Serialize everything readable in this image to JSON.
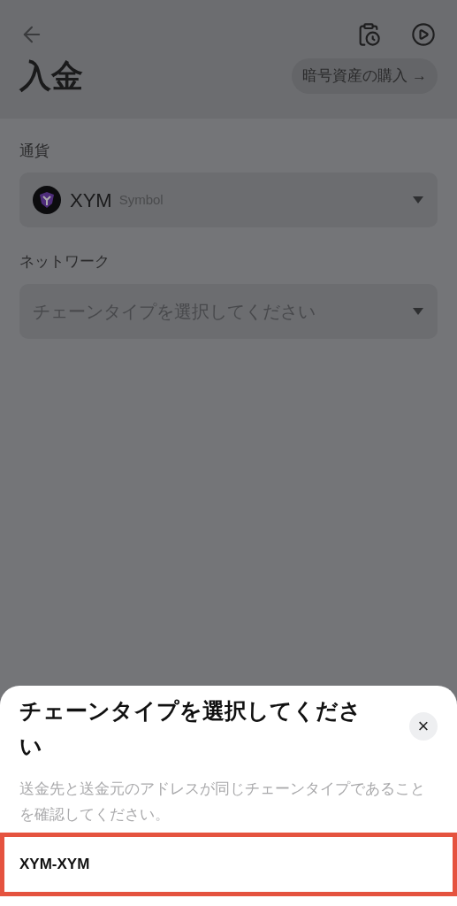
{
  "header": {
    "title": "入金",
    "buy_button": "暗号資産の購入 →"
  },
  "currency": {
    "label": "通貨",
    "code": "XYM",
    "name": "Symbol"
  },
  "network": {
    "label": "ネットワーク",
    "placeholder": "チェーンタイプを選択してください"
  },
  "sheet": {
    "title": "チェーンタイプを選択してください",
    "close": "×",
    "description": "送金先と送金元のアドレスが同じチェーンタイプであることを確認してください。",
    "options": [
      {
        "label": "XYM-XYM",
        "highlighted": true
      }
    ]
  }
}
